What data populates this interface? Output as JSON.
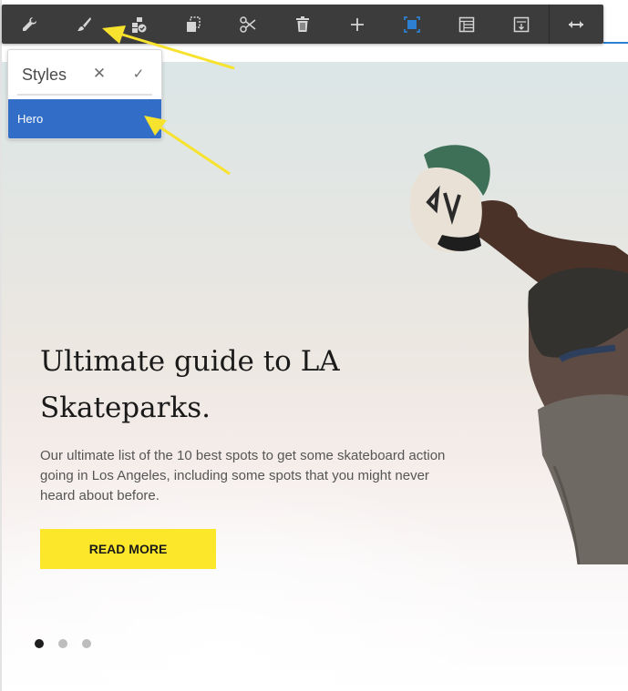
{
  "toolbar": {
    "items": [
      {
        "name": "configure",
        "icon": "wrench-icon"
      },
      {
        "name": "styles",
        "icon": "paintbrush-icon"
      },
      {
        "name": "policy",
        "icon": "policy-icon"
      },
      {
        "name": "copy",
        "icon": "copy-icon"
      },
      {
        "name": "cut",
        "icon": "scissors-icon"
      },
      {
        "name": "delete",
        "icon": "trash-icon"
      },
      {
        "name": "insert",
        "icon": "plus-icon"
      },
      {
        "name": "select-parent",
        "icon": "select-parent-icon"
      },
      {
        "name": "layout",
        "icon": "table-layout-icon"
      },
      {
        "name": "group",
        "icon": "group-icon"
      },
      {
        "name": "resize",
        "icon": "resize-horizontal-icon"
      }
    ],
    "icon_color": "#d5d5d5",
    "active_icon_color": "#2d7fd1"
  },
  "styles_popover": {
    "title": "Styles",
    "close_glyph": "✕",
    "confirm_glyph": "✓",
    "items": [
      {
        "label": "Hero",
        "selected": true
      }
    ],
    "selected_color": "#326ec8"
  },
  "hero": {
    "title_line1": "Ultimate guide to LA",
    "title_line2": "Skateparks.",
    "description": "Our ultimate list of the 10 best spots to get some skateboard action going in Los Angeles, including some spots that you might never heard about before.",
    "cta_label": "READ MORE",
    "cta_color": "#fde72a"
  },
  "carousel": {
    "total_slides": 3,
    "active_index": 0
  },
  "annotation_color": "#f7e22e"
}
